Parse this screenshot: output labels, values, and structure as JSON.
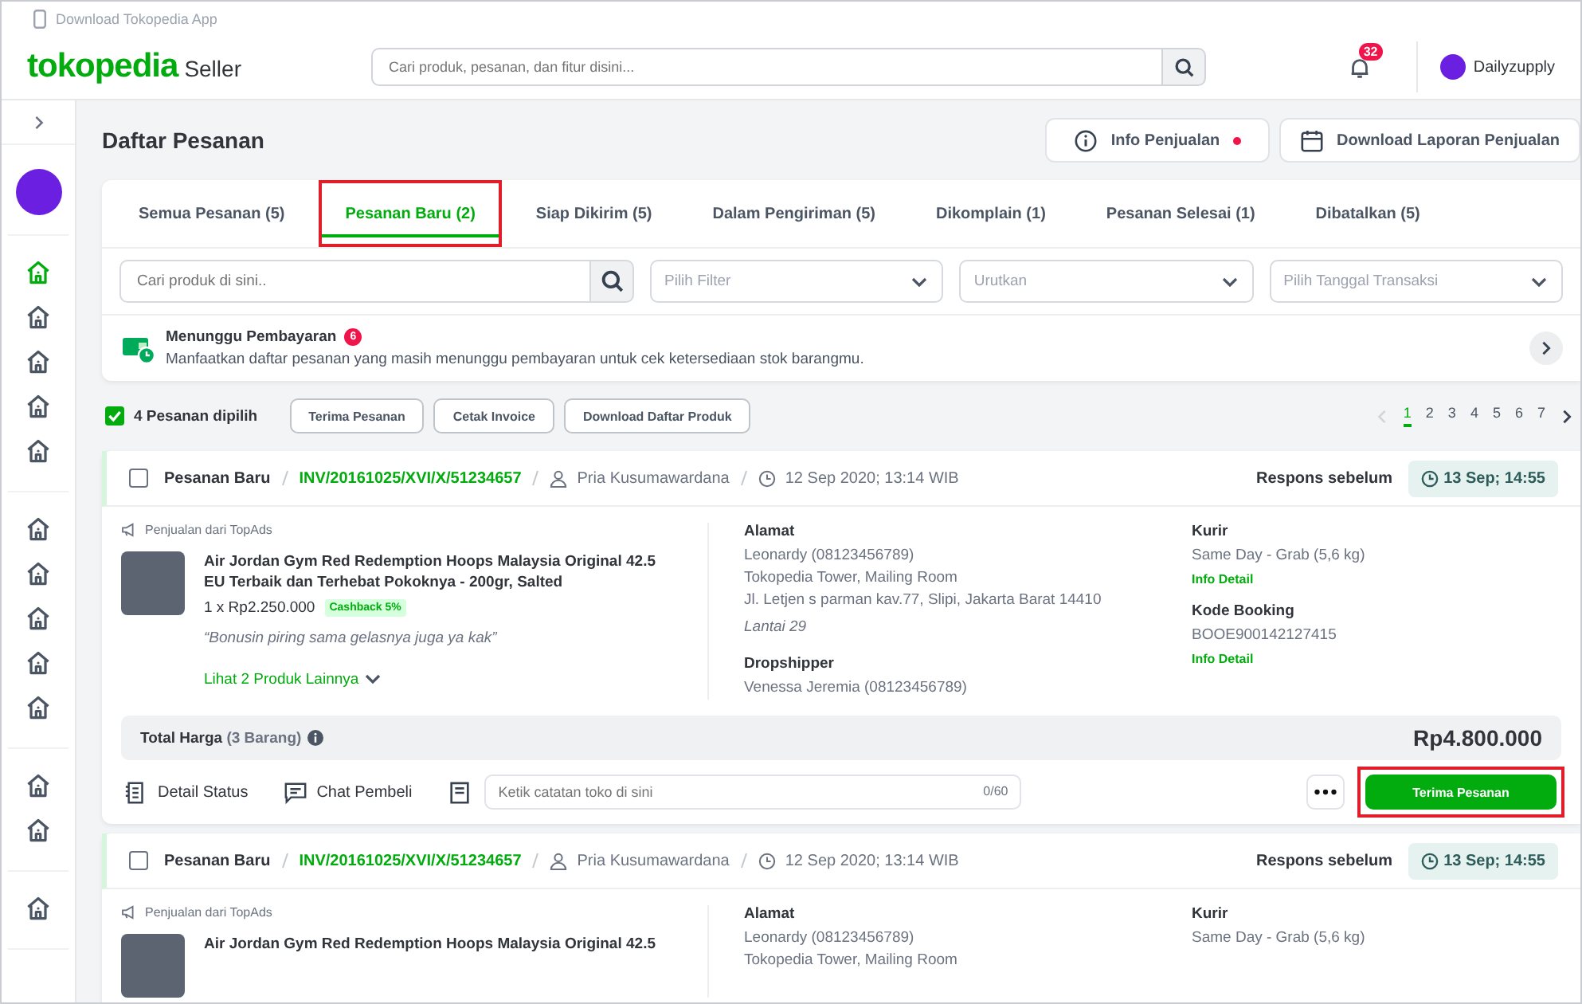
{
  "app_banner": {
    "label": "Download Tokopedia App"
  },
  "header": {
    "logo": "tokopedia",
    "logo_suffix": "Seller",
    "search": {
      "placeholder": "Cari produk, pesanan, dan fitur disini..."
    },
    "notifications": "32",
    "shop": {
      "name": "Dailyzupply"
    }
  },
  "sidebar": {
    "groups": [
      [
        {
          "selected": true
        },
        {
          "selected": false
        },
        {
          "selected": false
        },
        {
          "selected": false
        },
        {
          "selected": false
        }
      ],
      [
        {
          "selected": false
        },
        {
          "selected": false
        },
        {
          "selected": false
        },
        {
          "selected": false
        },
        {
          "selected": false
        }
      ],
      [
        {
          "selected": false
        },
        {
          "selected": false
        }
      ],
      [
        {
          "selected": false
        }
      ]
    ]
  },
  "page": {
    "title": "Daftar Pesanan",
    "actions": [
      {
        "kind": "info",
        "label": "Info Penjualan",
        "dot": true
      },
      {
        "kind": "calendar",
        "label": "Download Laporan Penjualan",
        "dot": false
      }
    ]
  },
  "tabs": [
    {
      "label": "Semua Pesanan (5)",
      "selected": false,
      "highlighted": false
    },
    {
      "label": "Pesanan Baru (2)",
      "selected": true,
      "highlighted": true
    },
    {
      "label": "Siap Dikirim (5)",
      "selected": false,
      "highlighted": false
    },
    {
      "label": "Dalam Pengiriman (5)",
      "selected": false,
      "highlighted": false
    },
    {
      "label": "Dikomplain (1)",
      "selected": false,
      "highlighted": false
    },
    {
      "label": "Pesanan Selesai (1)",
      "selected": false,
      "highlighted": false
    },
    {
      "label": "Dibatalkan (5)",
      "selected": false,
      "highlighted": false
    }
  ],
  "filters": {
    "search": {
      "placeholder": "Cari produk di sini.."
    },
    "dropdowns": [
      {
        "placeholder": "Pilih Filter"
      },
      {
        "placeholder": "Urutkan"
      },
      {
        "placeholder": "Pilih Tanggal Transaksi"
      }
    ]
  },
  "waiting_payment": {
    "title": "Menunggu Pembayaran",
    "count": "6",
    "description": "Manfaatkan daftar pesanan yang masih menunggu pembayaran untuk cek ketersediaan stok barangmu."
  },
  "bulk": {
    "checked": true,
    "label": "4 Pesanan dipilih",
    "buttons": [
      "Terima Pesanan",
      "Cetak Invoice",
      "Download Daftar Produk"
    ]
  },
  "pagination": {
    "prev_disabled": true,
    "pages": [
      {
        "label": "1",
        "selected": true
      },
      {
        "label": "2",
        "selected": false
      },
      {
        "label": "3",
        "selected": false
      },
      {
        "label": "4",
        "selected": false
      },
      {
        "label": "5",
        "selected": false
      },
      {
        "label": "6",
        "selected": false
      },
      {
        "label": "7",
        "selected": false
      }
    ]
  },
  "orders": [
    {
      "checked": false,
      "status": "Pesanan Baru",
      "invoice": "INV/20161025/XVI/X/51234657",
      "buyer": "Pria Kusumawardana",
      "date": "12 Sep 2020; 13:14 WIB",
      "deadline_label": "Respons sebelum",
      "deadline": "13 Sep; 14:55",
      "source": "Penjualan dari TopAds",
      "product": {
        "name": [
          "Air Jordan Gym Red Redemption Hoops Malaysia Original 42.5",
          "EU Terbaik dan Terhebat Pokoknya - 200gr, Salted"
        ],
        "qty_price": "1 x Rp2.250.000",
        "cashback": "Cashback 5%",
        "note": "“Bonusin piring sama gelasnya juga ya kak”"
      },
      "more_products": "Lihat 2 Produk Lainnya",
      "address": {
        "title": "Alamat",
        "lines": [
          "Leonardy (08123456789)",
          "Tokopedia Tower, Mailing Room",
          "Jl. Letjen s parman kav.77, Slipi, Jakarta Barat 14410"
        ],
        "extra": "Lantai 29"
      },
      "dropshipper": {
        "title": "Dropshipper",
        "value": "Venessa Jeremia (08123456789)"
      },
      "courier": {
        "title": "Kurir",
        "value": "Same Day - Grab (5,6 kg)",
        "link": "Info Detail"
      },
      "booking": {
        "title": "Kode Booking",
        "value": "BOOE900142127415",
        "link": "Info Detail"
      },
      "total": {
        "label": "Total Harga",
        "count": "(3 Barang)",
        "value": "Rp4.800.000"
      },
      "footer": {
        "detail": "Detail Status",
        "chat": "Chat Pembeli",
        "note": {
          "placeholder": "Ketik catatan toko di sini",
          "counter": "0/60"
        },
        "accept": "Terima Pesanan",
        "accept_highlighted": true
      }
    },
    {
      "checked": false,
      "status": "Pesanan Baru",
      "invoice": "INV/20161025/XVI/X/51234657",
      "buyer": "Pria Kusumawardana",
      "date": "12 Sep 2020; 13:14 WIB",
      "deadline_label": "Respons sebelum",
      "deadline": "13 Sep; 14:55",
      "source": "Penjualan dari TopAds",
      "product": {
        "name": [
          "Air Jordan Gym Red Redemption Hoops Malaysia Original 42.5"
        ]
      },
      "address": {
        "title": "Alamat",
        "lines": [
          "Leonardy (08123456789)",
          "Tokopedia Tower, Mailing Room"
        ]
      },
      "courier": {
        "title": "Kurir",
        "value": "Same Day - Grab (5,6 kg)"
      }
    }
  ]
}
